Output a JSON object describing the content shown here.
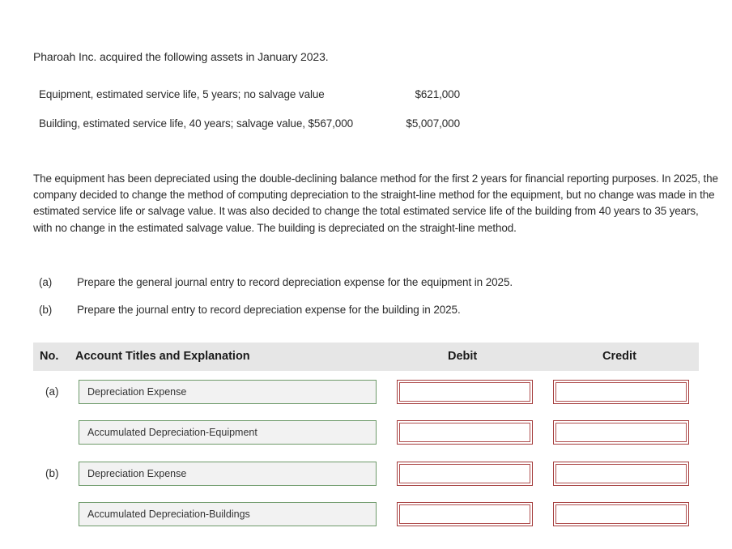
{
  "intro": "Pharoah Inc. acquired the following assets in January 2023.",
  "assets": [
    {
      "label": "Equipment, estimated service life, 5 years; no salvage value",
      "value": "$621,000"
    },
    {
      "label": "Building, estimated service life, 40 years; salvage value, $567,000",
      "value": "$5,007,000"
    }
  ],
  "paragraph": "The equipment has been depreciated using the double-declining balance method for the first 2 years for financial reporting purposes. In 2025, the company decided to change the method of computing depreciation to the straight-line method for the equipment, but no change was made in the estimated service life or salvage value. It was also decided to change the total estimated service life of the building from 40 years to 35 years, with no change in the estimated salvage value. The building is depreciated on the straight-line method.",
  "tasks": [
    {
      "label": "(a)",
      "text": "Prepare the general journal entry to record depreciation expense for the equipment in 2025."
    },
    {
      "label": "(b)",
      "text": "Prepare the journal entry to record depreciation expense for the building in 2025."
    }
  ],
  "table": {
    "headers": {
      "no": "No.",
      "account": "Account Titles and Explanation",
      "debit": "Debit",
      "credit": "Credit"
    },
    "rows": [
      {
        "no": "(a)",
        "account": "Depreciation Expense",
        "debit": "",
        "credit": ""
      },
      {
        "no": "",
        "account": "Accumulated Depreciation-Equipment",
        "debit": "",
        "credit": ""
      },
      {
        "no": "(b)",
        "account": "Depreciation Expense",
        "debit": "",
        "credit": ""
      },
      {
        "no": "",
        "account": "Accumulated Depreciation-Buildings",
        "debit": "",
        "credit": ""
      }
    ]
  }
}
